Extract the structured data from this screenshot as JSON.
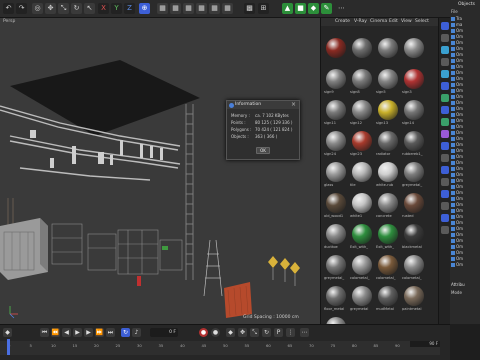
{
  "toolbar": {
    "icons": [
      "undo-icon",
      "redo-icon",
      "live-select-icon",
      "move-icon",
      "scale-icon",
      "rotate-icon",
      "x-axis-icon",
      "y-axis-icon",
      "z-axis-icon",
      "coordinate-icon",
      "render-view-icon",
      "render-icon",
      "render-settings-icon",
      "cube-icon",
      "pen-icon",
      "subdivision-icon",
      "array-icon",
      "deformer-icon",
      "scene-icon",
      "camera-icon",
      "light-icon"
    ],
    "axis_x": "X",
    "axis_y": "Y",
    "axis_z": "Z"
  },
  "viewport": {
    "label": "Persp",
    "grid_spacing": "Grid Spacing : 10000 cm"
  },
  "material_manager": {
    "menu": [
      "Create",
      "V-Ray",
      "Cinema",
      "Edit",
      "View",
      "Select"
    ],
    "materials": [
      {
        "name": "",
        "color": "#8a2a22"
      },
      {
        "name": "",
        "color": "#6e6e6e"
      },
      {
        "name": "",
        "color": "#7b7b7b"
      },
      {
        "name": "",
        "color": "#8a8a8a"
      },
      {
        "name": "sign9",
        "color": "#808080"
      },
      {
        "name": "sign8",
        "color": "#7a7a7a"
      },
      {
        "name": "sign5",
        "color": "#858585"
      },
      {
        "name": "sign3",
        "color": "#b03232"
      },
      {
        "name": "sign11",
        "color": "#7a7a7a"
      },
      {
        "name": "sign12",
        "color": "#888888"
      },
      {
        "name": "sign13",
        "color": "#c9b12a"
      },
      {
        "name": "sign14",
        "color": "#757575"
      },
      {
        "name": "sign24",
        "color": "#8b8b8b"
      },
      {
        "name": "sign23",
        "color": "#a83a2c"
      },
      {
        "name": "radiator",
        "color": "#6a6a6a"
      },
      {
        "name": "rubbereb1_",
        "color": "#5a5a5a"
      },
      {
        "name": "glass",
        "color": "#9a9a9a"
      },
      {
        "name": "tile",
        "color": "#b7b7b7"
      },
      {
        "name": "white-rub",
        "color": "#cfcfcf"
      },
      {
        "name": "greymetal_",
        "color": "#7d7d7d"
      },
      {
        "name": "old_wood1",
        "color": "#5a4a3a"
      },
      {
        "name": "white1",
        "color": "#c4c4c4"
      },
      {
        "name": "concrete",
        "color": "#8a8a8a"
      },
      {
        "name": "rusted",
        "color": "#6a4a3a"
      },
      {
        "name": "ducttoe",
        "color": "#8a8a8a"
      },
      {
        "name": "Exit_with_",
        "color": "#2e8f3e"
      },
      {
        "name": "Exit_with_",
        "color": "#2e8f3e"
      },
      {
        "name": "blackmetal",
        "color": "#3c3c3c"
      },
      {
        "name": "greymetal_",
        "color": "#777777"
      },
      {
        "name": "colometal_",
        "color": "#9a9a9a"
      },
      {
        "name": "colometal_",
        "color": "#7a5a3a"
      },
      {
        "name": "colometal_",
        "color": "#8a8a8a"
      },
      {
        "name": "floor_metal",
        "color": "#6e6e6e"
      },
      {
        "name": "greymetal",
        "color": "#8a8a8a"
      },
      {
        "name": "mudMetal",
        "color": "#5f5f5f"
      },
      {
        "name": "paintmetal",
        "color": "#7a6a5a"
      },
      {
        "name": "colometal_",
        "color": "#8e8e8e"
      }
    ]
  },
  "objects": {
    "title": "Objects",
    "menu": "File",
    "rows": [
      "Tra",
      "ma",
      "Om",
      "Om",
      "Om",
      "Om",
      "Om",
      "Om",
      "Om",
      "Om",
      "Om",
      "Om",
      "Om",
      "Om",
      "Om",
      "Om",
      "Om",
      "Om",
      "Om",
      "Om",
      "Om",
      "Om",
      "Om",
      "Om",
      "Om",
      "Om",
      "Om",
      "Om",
      "Om",
      "Om",
      "Om",
      "Om",
      "Om",
      "Om",
      "Om",
      "Om",
      "Om",
      "Om",
      "Om",
      "Om",
      "Om",
      "Om"
    ],
    "attributes_label": "Attribu",
    "mode_label": "Mode"
  },
  "info_dialog": {
    "title": "Information",
    "rows": [
      {
        "label": "Memory :",
        "value": "ca. 7 102 KBytes"
      },
      {
        "label": "Points :",
        "value": "80 125 ( 129 336 )"
      },
      {
        "label": "Polygons :",
        "value": "70 424 ( 121 824 )"
      },
      {
        "label": "Objects :",
        "value": "363 ( 366 )"
      }
    ],
    "ok_label": "OK"
  },
  "timeline": {
    "frame_field": "0 F",
    "ticks": [
      "0",
      "5",
      "10",
      "15",
      "20",
      "25",
      "30",
      "35",
      "40",
      "45",
      "50",
      "55",
      "60",
      "65",
      "70",
      "75",
      "80",
      "85",
      "90"
    ],
    "end_frame": "90 F"
  },
  "colors": {
    "accent": "#3d5fd6",
    "record": "#b13131",
    "viewport_bg": "#3a3a3a"
  }
}
